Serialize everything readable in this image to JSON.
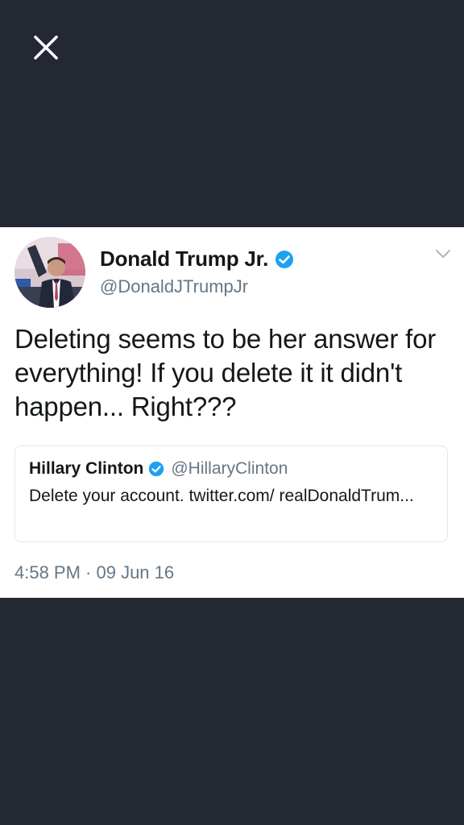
{
  "overlay": {
    "close_icon": "close-icon",
    "background_color": "#242832"
  },
  "tweet": {
    "author_name": "Donald Trump Jr.",
    "author_handle": "@DonaldJTrumpJr",
    "verified_icon": "verified-badge-icon",
    "menu_icon": "chevron-down-icon",
    "text": "Deleting seems to be her answer for everything! If you delete it it didn't happen... Right???",
    "timestamp": "4:58 PM · 09 Jun 16",
    "quoted": {
      "author_name": "Hillary Clinton",
      "author_handle": "@HillaryClinton",
      "text": "Delete your account. twitter.com/ realDonaldTrum..."
    }
  },
  "colors": {
    "verified": "#1da1f2",
    "secondary_text": "#657786",
    "primary_text": "#14171a"
  }
}
